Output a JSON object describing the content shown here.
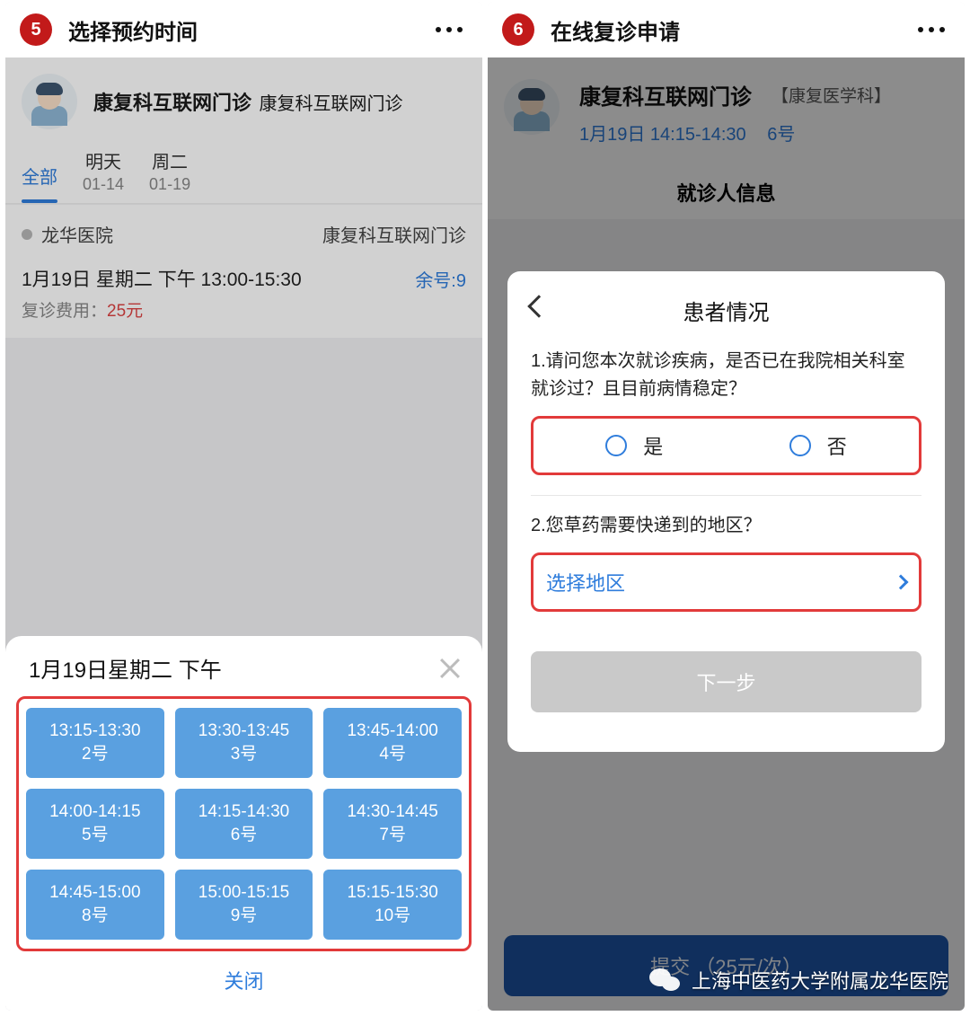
{
  "left": {
    "step": "5",
    "header_title": "选择预约时间",
    "doctor": {
      "title": "康复科互联网门诊",
      "subtitle": "康复科互联网门诊"
    },
    "tabs": {
      "all": "全部",
      "items": [
        {
          "label": "明天",
          "date": "01-14"
        },
        {
          "label": "周二",
          "date": "01-19"
        }
      ]
    },
    "slot": {
      "hospital": "龙华医院",
      "dept": "康复科互联网门诊",
      "datetime": "1月19日  星期二  下午  13:00-15:30",
      "remain_label": "余号:9",
      "fee_label": "复诊费用：",
      "fee_value": "25元"
    },
    "sheet": {
      "title": "1月19日星期二  下午",
      "close": "关闭",
      "slots": [
        {
          "time": "13:15-13:30",
          "no": "2号"
        },
        {
          "time": "13:30-13:45",
          "no": "3号"
        },
        {
          "time": "13:45-14:00",
          "no": "4号"
        },
        {
          "time": "14:00-14:15",
          "no": "5号"
        },
        {
          "time": "14:15-14:30",
          "no": "6号"
        },
        {
          "time": "14:30-14:45",
          "no": "7号"
        },
        {
          "time": "14:45-15:00",
          "no": "8号"
        },
        {
          "time": "15:00-15:15",
          "no": "9号"
        },
        {
          "time": "15:15-15:30",
          "no": "10号"
        }
      ]
    }
  },
  "right": {
    "step": "6",
    "header_title": "在线复诊申请",
    "doctor": {
      "dept": "康复科互联网门诊",
      "tag": "【康复医学科】",
      "time": "1月19日 14:15-14:30",
      "no": "6号"
    },
    "info_title": "就诊人信息",
    "popup": {
      "title": "患者情况",
      "q1": "1.请问您本次就诊疾病，是否已在我院相关科室就诊过？且目前病情稳定？",
      "yes": "是",
      "no": "否",
      "q2": "2.您草药需要快递到的地区？",
      "region_label": "选择地区",
      "next": "下一步"
    },
    "submit": "提交 （25元/次）"
  },
  "wechat_caption": "上海中医药大学附属龙华医院"
}
